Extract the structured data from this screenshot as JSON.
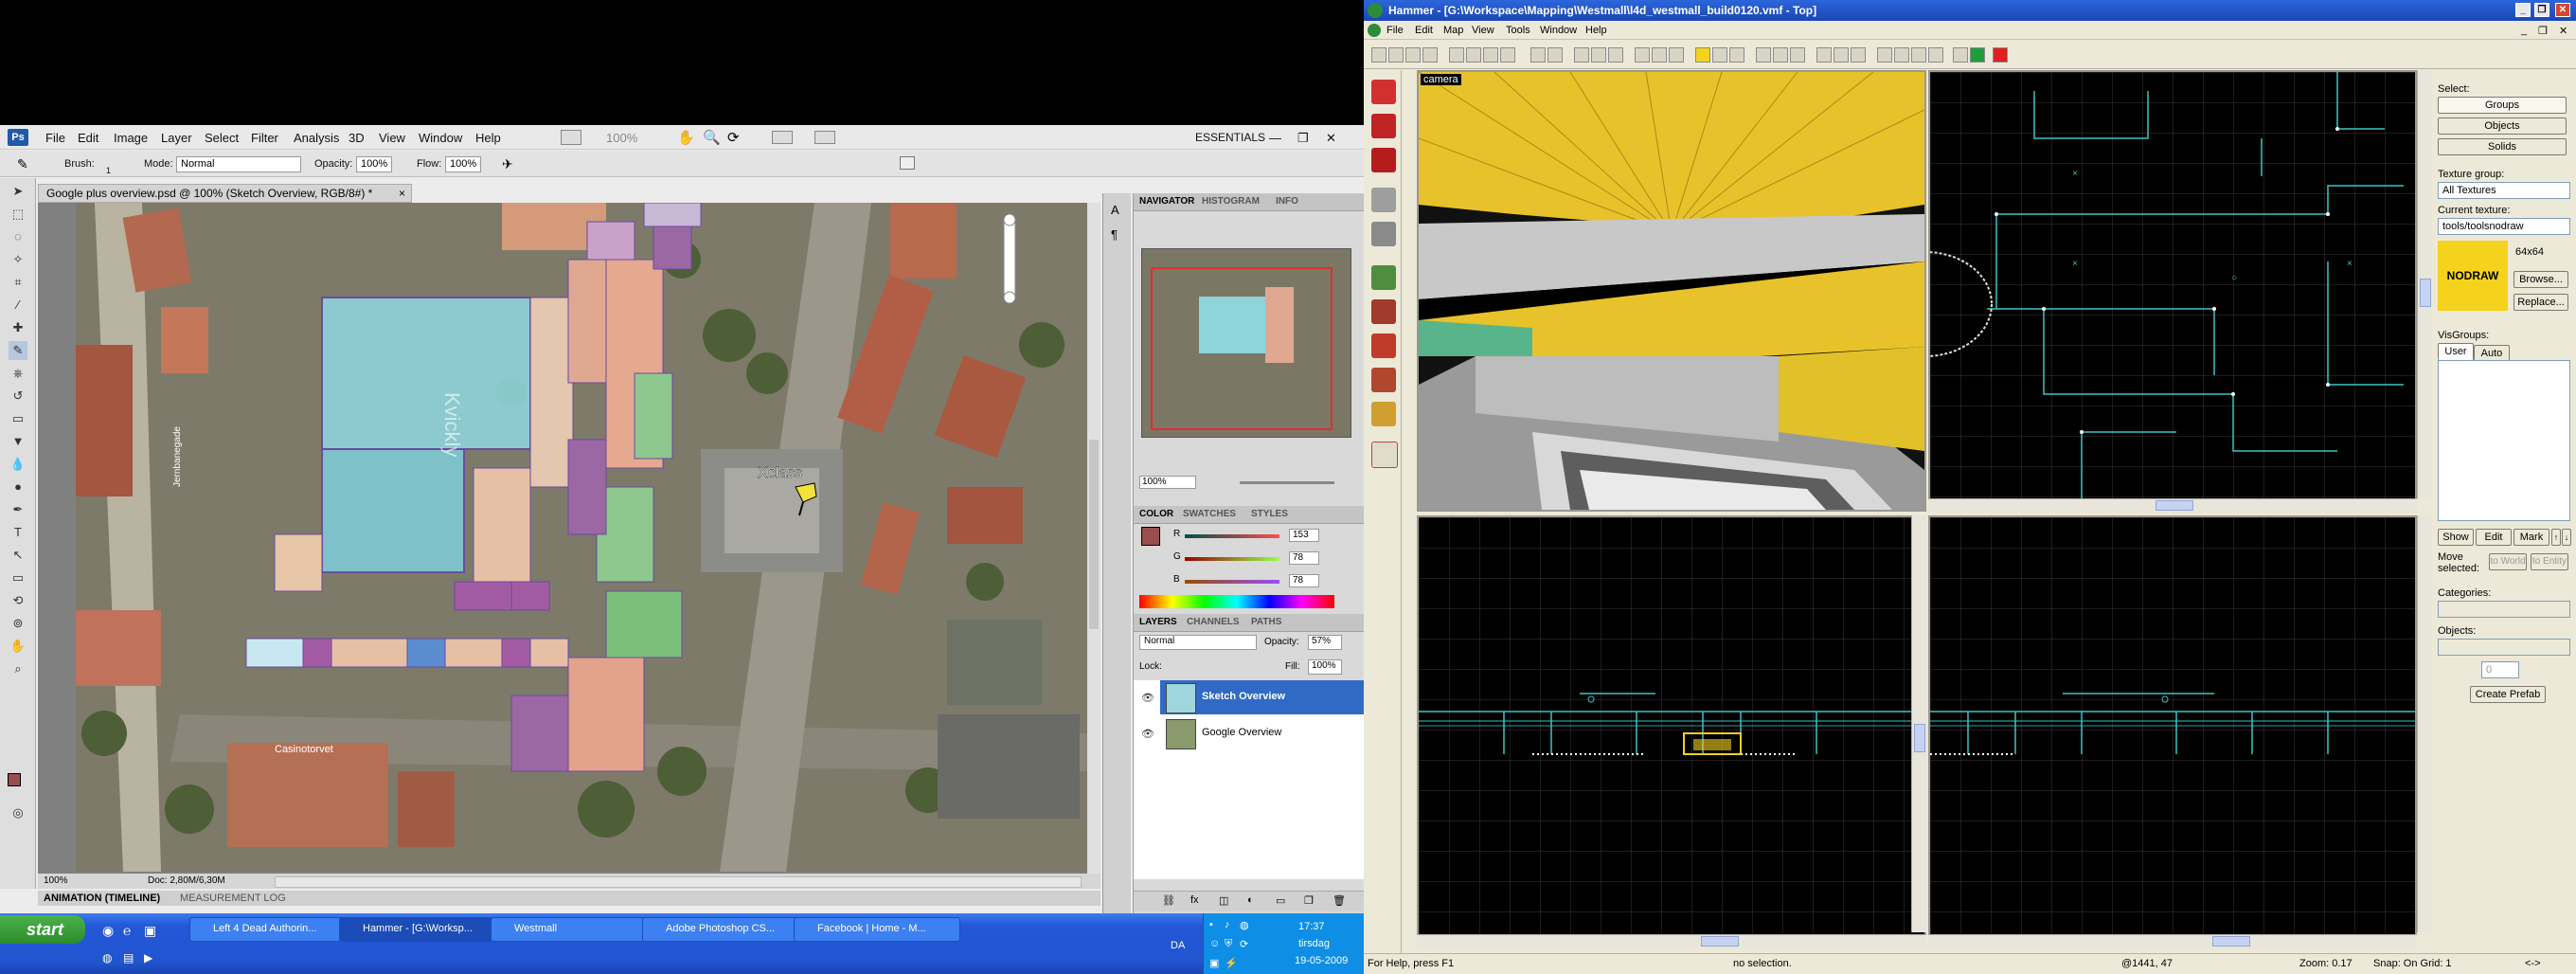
{
  "photoshop": {
    "logo": "Ps",
    "menu": [
      "File",
      "Edit",
      "Image",
      "Layer",
      "Select",
      "Filter",
      "Analysis",
      "3D",
      "View",
      "Window",
      "Help"
    ],
    "zoom_menu": "100%",
    "workspace": "ESSENTIALS",
    "options": {
      "brush_label": "Brush:",
      "brush_size": "1",
      "mode_label": "Mode:",
      "mode_value": "Normal",
      "opacity_label": "Opacity:",
      "opacity_value": "100%",
      "flow_label": "Flow:",
      "flow_value": "100%"
    },
    "document_tab": "Google plus overview.psd @ 100% (Sketch Overview, RGB/8#) *",
    "canvas_labels": {
      "xclass": "Xclass",
      "casino": "Casinotorvet",
      "street": "Jernbanegade",
      "vertical": "Kvickly"
    },
    "status": {
      "zoom": "100%",
      "doc": "Doc: 2,80M/6,30M"
    },
    "bottom_tabs": [
      "ANIMATION (TIMELINE)",
      "MEASUREMENT LOG"
    ],
    "navigator": {
      "tabs": [
        "NAVIGATOR",
        "HISTOGRAM",
        "INFO"
      ],
      "zoom": "100%"
    },
    "color": {
      "tabs": [
        "COLOR",
        "SWATCHES",
        "STYLES"
      ],
      "r_label": "R",
      "g_label": "G",
      "b_label": "B",
      "r": "153",
      "g": "78",
      "b": "78",
      "swatch": "#994e4e"
    },
    "layers": {
      "tabs": [
        "LAYERS",
        "CHANNELS",
        "PATHS"
      ],
      "blend": "Normal",
      "opacity_label": "Opacity:",
      "opacity": "57%",
      "lock_label": "Lock:",
      "fill_label": "Fill:",
      "fill": "100%",
      "items": [
        {
          "name": "Sketch Overview",
          "selected": true
        },
        {
          "name": "Google Overview",
          "selected": false
        }
      ]
    }
  },
  "hammer": {
    "title": "Hammer - [G:\\Workspace\\Mapping\\Westmall\\l4d_westmall_build0120.vmf - Top]",
    "menu": [
      "File",
      "Edit",
      "Map",
      "View",
      "Tools",
      "Window",
      "Help"
    ],
    "camera_label": "camera",
    "select": {
      "label": "Select:",
      "buttons": [
        "Groups",
        "Objects",
        "Solids"
      ]
    },
    "texture": {
      "group_label": "Texture group:",
      "group_value": "All Textures",
      "current_label": "Current texture:",
      "current_value": "tools/toolsnodraw",
      "preview_text": "NODRAW",
      "size": "64x64",
      "browse": "Browse...",
      "replace": "Replace..."
    },
    "visgroups": {
      "label": "VisGroups:",
      "tabs": [
        "User",
        "Auto"
      ],
      "buttons": [
        "Show",
        "Edit",
        "Mark"
      ]
    },
    "move_selected": {
      "label": "Move selected:",
      "world": "to World",
      "entity": "to Entity"
    },
    "categories_label": "Categories:",
    "objects_label": "Objects:",
    "objects_count": "0",
    "create_prefab": "Create Prefab",
    "status": {
      "help": "For Help, press F1",
      "selection": "no selection.",
      "coords": "@1441, 47",
      "zoom": "Zoom: 0.17",
      "snap": "Snap: On Grid: 1",
      "arrows": "<->"
    }
  },
  "taskbar": {
    "start": "start",
    "tasks": [
      {
        "label": "Left 4 Dead Authorin...",
        "active": false
      },
      {
        "label": "Hammer - [G:\\Worksp...",
        "active": true
      },
      {
        "label": "Westmall",
        "active": false
      },
      {
        "label": "Adobe Photoshop CS...",
        "active": false
      },
      {
        "label": "Facebook | Home - M...",
        "active": false
      }
    ],
    "lang": "DA",
    "time": "17:37",
    "day": "tirsdag",
    "date": "19-05-2009"
  },
  "colors": {
    "xp_blue": "#2155d0",
    "hammer_bg": "#ece9d8",
    "photoshop_bg": "#ececec",
    "selection_blue": "#316ac5",
    "nodraw_yellow": "#f5d21c",
    "grid_cyan": "#3ec4c4"
  }
}
